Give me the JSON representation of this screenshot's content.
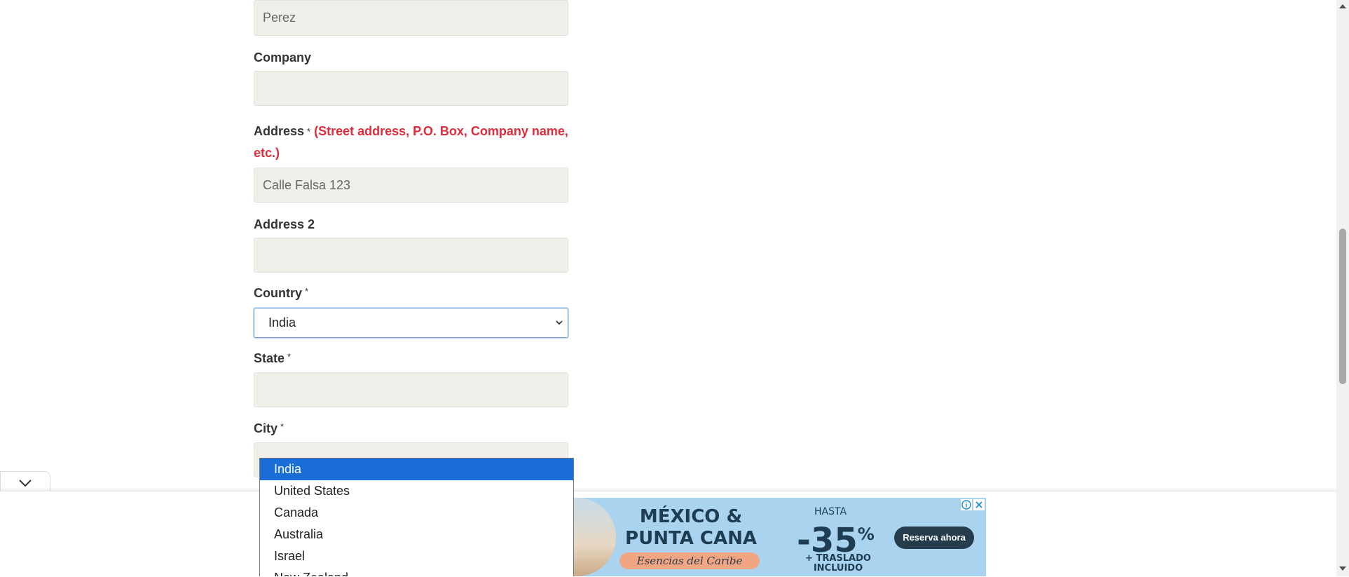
{
  "form": {
    "last_name_value": "Perez",
    "company_label": "Company",
    "company_value": "",
    "address_label": "Address",
    "address_required": "*",
    "address_hint_line1": "(Street address, P.O. Box, Company name,",
    "address_hint_line2": "etc.)",
    "address_value": "Calle Falsa 123",
    "address2_label": "Address 2",
    "address2_value": "",
    "country_label": "Country",
    "country_required": "*",
    "country_selected": "India",
    "state_label": "State",
    "state_required": "*",
    "state_value": "",
    "city_label": "City",
    "city_required": "*"
  },
  "country_dropdown": {
    "options": [
      "India",
      "United States",
      "Canada",
      "Australia",
      "Israel",
      "New Zealand"
    ],
    "highlighted_index": 0
  },
  "ad": {
    "headline_line1": "MÉXICO &",
    "headline_line2": "PUNTA CANA",
    "tagline": "Esencias del Caribe",
    "prefix": "HASTA",
    "discount": "-35",
    "discount_unit": "%",
    "extra_line1": "+ TRASLADO",
    "extra_line2": "INCLUIDO",
    "cta": "Reserva ahora",
    "background_color": "#a9d3ee"
  },
  "colors": {
    "required_hint": "#e02b3a",
    "input_bg": "#f0efe9",
    "dropdown_highlight": "#1a6cd7"
  }
}
